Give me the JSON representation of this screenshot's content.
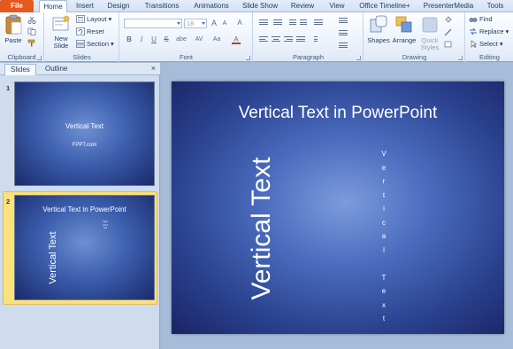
{
  "tabs": [
    "File",
    "Home",
    "Insert",
    "Design",
    "Transitions",
    "Animations",
    "Slide Show",
    "Review",
    "View",
    "Office Timeline+",
    "PresenterMedia",
    "Tools"
  ],
  "ribbon": {
    "clipboard": {
      "paste": "Paste",
      "label": "Clipboard"
    },
    "slides": {
      "new_slide": "New Slide",
      "layout": "Layout",
      "reset": "Reset",
      "section": "Section",
      "label": "Slides"
    },
    "font": {
      "size": "18",
      "grow": "A",
      "shrink": "A",
      "clear": "A",
      "bold": "B",
      "italic": "I",
      "underline": "U",
      "strike": "S",
      "shadow": "abe",
      "spacing": "AV",
      "case": "Aa",
      "color": "A",
      "label": "Font"
    },
    "paragraph": {
      "label": "Paragraph"
    },
    "drawing": {
      "shapes": "Shapes",
      "arrange": "Arrange",
      "quick_styles": "Quick Styles",
      "label": "Drawing"
    },
    "editing": {
      "find": "Find",
      "replace": "Replace",
      "select": "Select",
      "label": "Editing"
    }
  },
  "panel": {
    "tabs": [
      "Slides",
      "Outline"
    ],
    "close": "×",
    "thumbs": [
      {
        "number": "1",
        "title": "Vertical Text",
        "subtitle": "FPPT.com"
      },
      {
        "number": "2",
        "title": "Vertical Text in PowerPoint",
        "rotated": "Vertical Text",
        "stacked": "Vertical Text"
      }
    ]
  },
  "slide": {
    "title": "Vertical Text in PowerPoint",
    "rotated_text": "Vertical Text",
    "stacked_letters": [
      "V",
      "e",
      "r",
      "t",
      "i",
      "c",
      "a",
      "l",
      "",
      "T",
      "e",
      "x",
      "t"
    ]
  },
  "colors": {
    "file_tab": "#e5591f",
    "slide_bg": "#2a418e",
    "selected_thumb": "#fbe27c"
  }
}
